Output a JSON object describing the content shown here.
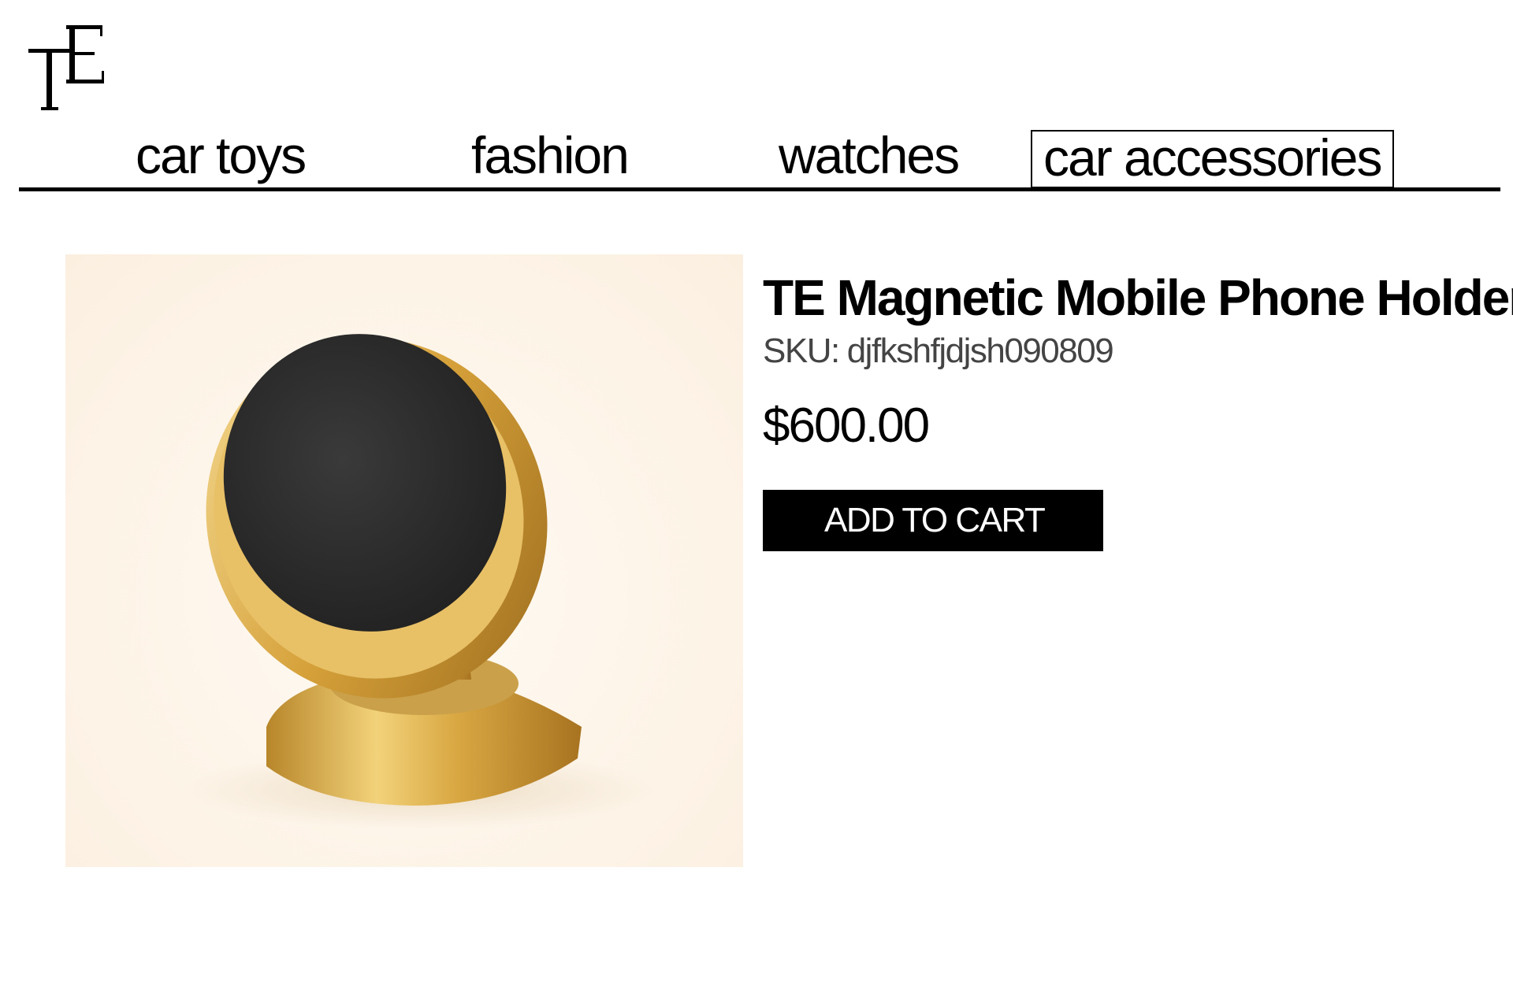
{
  "brand": {
    "logo_text": "TE"
  },
  "nav": {
    "items": [
      {
        "label": "car toys",
        "active": false
      },
      {
        "label": "fashion",
        "active": false
      },
      {
        "label": "watches",
        "active": false
      },
      {
        "label": "car accessories",
        "active": true
      }
    ]
  },
  "product": {
    "title": "TE Magnetic Mobile Phone Holder",
    "sku_label": "SKU:",
    "sku_value": "djfkshfjdjsh090809",
    "price": "$600.00",
    "add_to_cart_label": "ADD TO CART",
    "image_icon": "magnetic-phone-holder-image"
  },
  "colors": {
    "text": "#000000",
    "button_bg": "#000000",
    "button_text": "#ffffff",
    "image_bg": "#fdf3e6",
    "gold": "#d4a640",
    "magnet_pad": "#2e2e2e"
  }
}
